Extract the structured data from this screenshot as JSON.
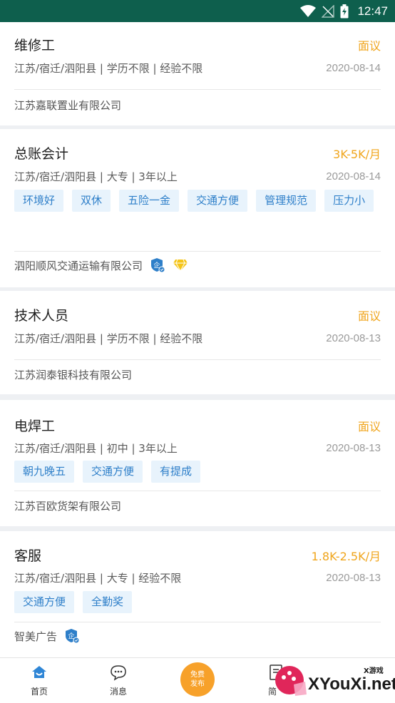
{
  "status_bar": {
    "time": "12:47"
  },
  "jobs": [
    {
      "title": "维修工",
      "salary": "面议",
      "meta": "江苏/宿迁/泗阳县 | 学历不限 | 经验不限",
      "date": "2020-08-14",
      "tags": [],
      "company": "江苏嘉联置业有限公司",
      "badges": []
    },
    {
      "title": "总账会计",
      "salary": "3K-5K/月",
      "meta": "江苏/宿迁/泗阳县 | 大专 | 3年以上",
      "date": "2020-08-14",
      "tags": [
        "环境好",
        "双休",
        "五险一金",
        "交通方便",
        "管理规范",
        "压力小"
      ],
      "company": "泗阳顺风交通运输有限公司",
      "badges": [
        "verified-company-icon",
        "diamond-icon"
      ]
    },
    {
      "title": "技术人员",
      "salary": "面议",
      "meta": "江苏/宿迁/泗阳县 | 学历不限 | 经验不限",
      "date": "2020-08-13",
      "tags": [],
      "company": "江苏润泰银科技有限公司",
      "badges": []
    },
    {
      "title": "电焊工",
      "salary": "面议",
      "meta": "江苏/宿迁/泗阳县 | 初中 | 3年以上",
      "date": "2020-08-13",
      "tags": [
        "朝九晚五",
        "交通方便",
        "有提成"
      ],
      "company": "江苏百欧货架有限公司",
      "badges": []
    },
    {
      "title": "客服",
      "salary": "1.8K-2.5K/月",
      "meta": "江苏/宿迁/泗阳县 | 大专 | 经验不限",
      "date": "2020-08-13",
      "tags": [
        "交通方便",
        "全勤奖"
      ],
      "company": "智美广告",
      "badges": [
        "verified-company-icon"
      ]
    }
  ],
  "bottom_nav": {
    "home": "首页",
    "messages": "消息",
    "publish_line1": "免费",
    "publish_line2": "发布",
    "resume": "简"
  },
  "watermark": {
    "brand": "XYouXi.net",
    "small": "X游戏"
  },
  "colors": {
    "status_bar": "#0e5f4d",
    "salary": "#f0a51c",
    "tag_text": "#2e7fc9",
    "tag_bg": "#e8f3fc",
    "nav_active": "#2f86d6"
  }
}
